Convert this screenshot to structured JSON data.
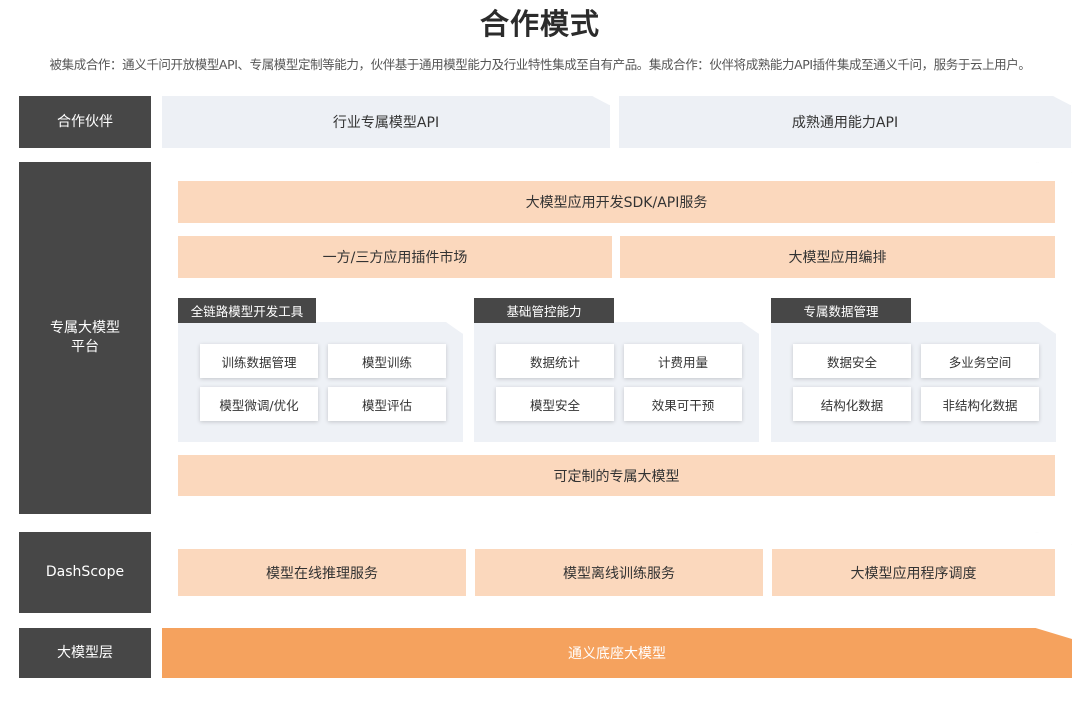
{
  "title": "合作模式",
  "subtitle": "被集成合作：通义千问开放模型API、专属模型定制等能力，伙伴基于通用模型能力及行业特性集成至自有产品。集成合作：伙伴将成熟能力API插件集成至通义千问，服务于云上用户。",
  "layers": {
    "partner": {
      "label": "合作伙伴",
      "items": [
        "行业专属模型API",
        "成熟通用能力API"
      ]
    },
    "platform": {
      "label": "专属大模型\n平台",
      "sdk": "大模型应用开发SDK/API服务",
      "plugin_market": "一方/三方应用插件市场",
      "orchestration": "大模型应用编排",
      "groups": [
        {
          "tag": "全链路模型开发工具",
          "chips": [
            "训练数据管理",
            "模型训练",
            "模型微调/优化",
            "模型评估"
          ]
        },
        {
          "tag": "基础管控能力",
          "chips": [
            "数据统计",
            "计费用量",
            "模型安全",
            "效果可干预"
          ]
        },
        {
          "tag": "专属数据管理",
          "chips": [
            "数据安全",
            "多业务空间",
            "结构化数据",
            "非结构化数据"
          ]
        }
      ],
      "custom_model": "可定制的专属大模型"
    },
    "dashscope": {
      "label": "DashScope",
      "items": [
        "模型在线推理服务",
        "模型离线训练服务",
        "大模型应用程序调度"
      ]
    },
    "model": {
      "label": "大模型层",
      "base": "通义底座大模型"
    }
  },
  "colors": {
    "dark_label": "#474747",
    "peach": "#fbd8bd",
    "orange": "#f5a25e",
    "panel": "#edf0f5"
  }
}
